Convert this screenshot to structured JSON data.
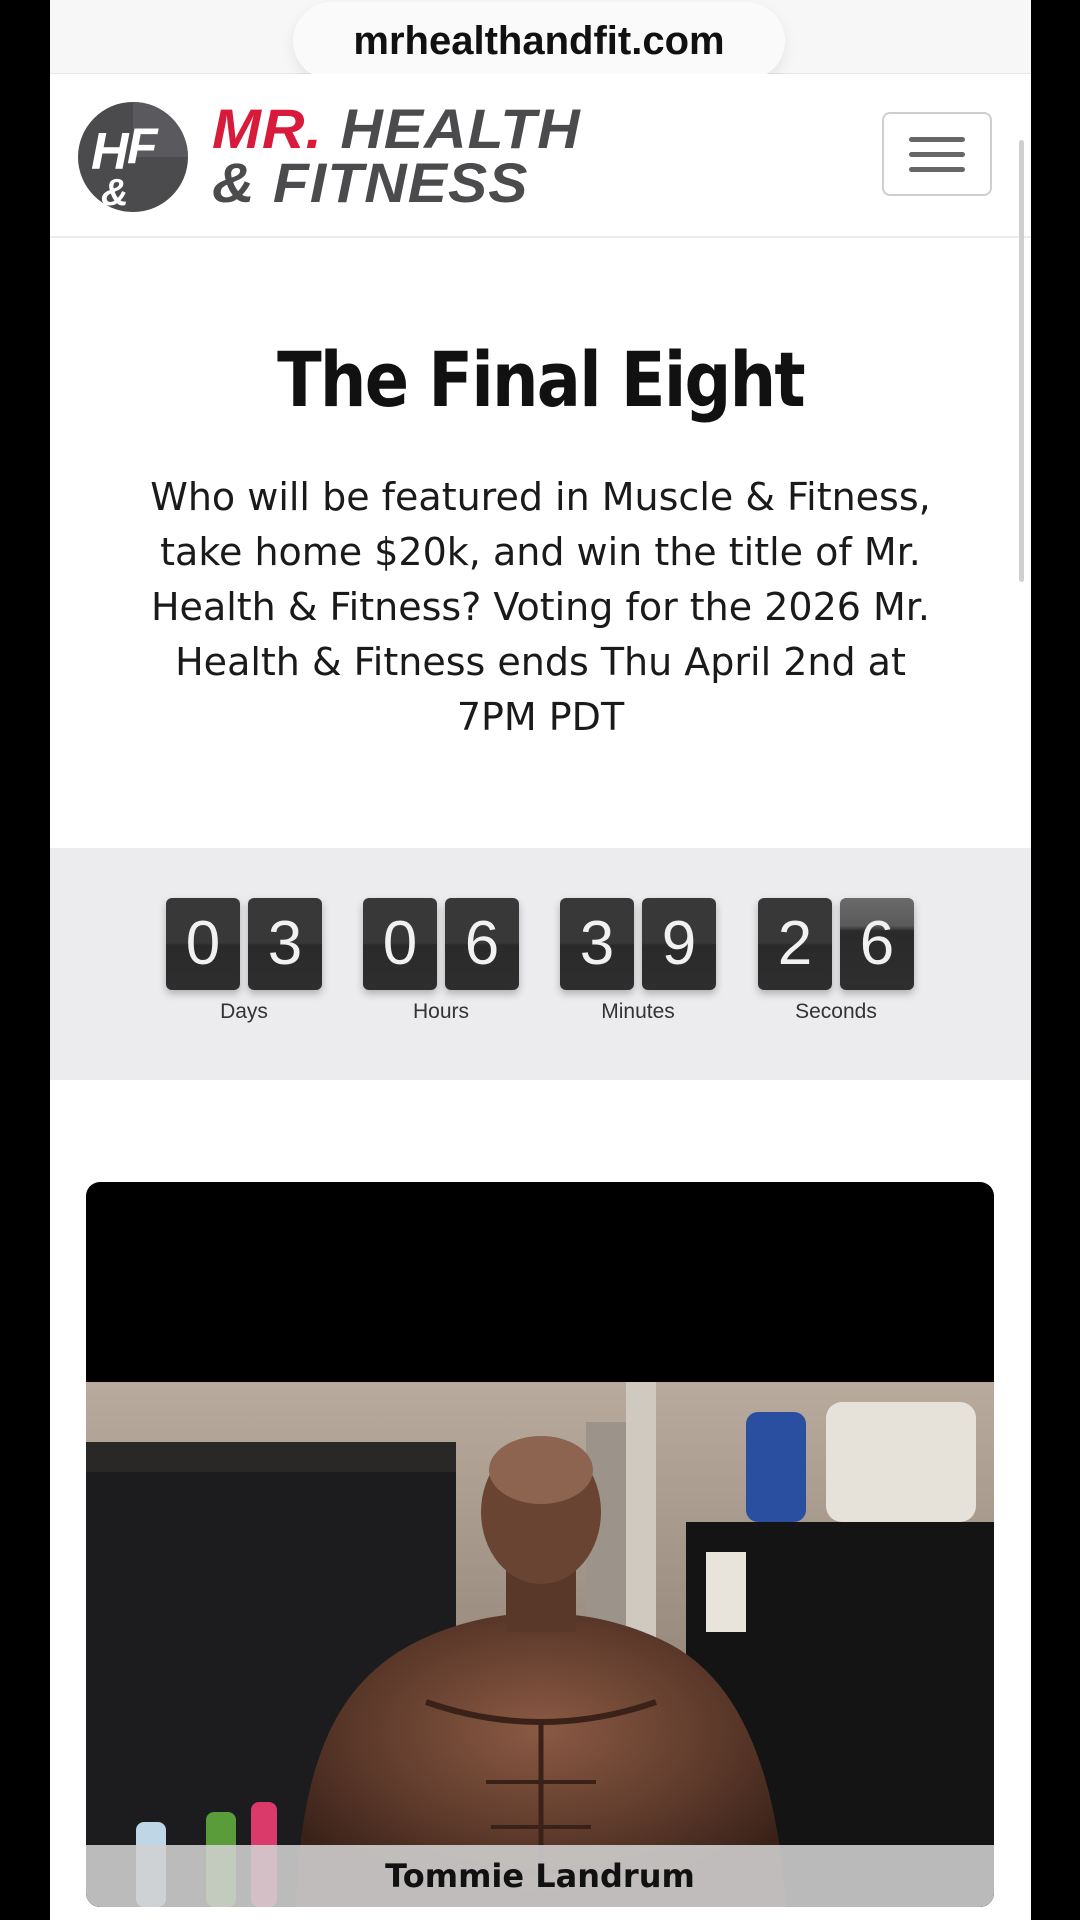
{
  "browser": {
    "url": "mrhealthandfit.com"
  },
  "header": {
    "logo_mark": "H F &",
    "logo_line1_mr": "MR.",
    "logo_line1_rest": "HEALTH",
    "logo_line2": "& FITNESS",
    "menu_icon": "hamburger-icon"
  },
  "hero": {
    "title": "The Final Eight",
    "description": "Who will be featured in Muscle & Fitness, take home $20k, and win the title of Mr. Health & Fitness? Voting for the 2026 Mr. Health & Fitness ends Thu April 2nd at 7PM PDT"
  },
  "countdown": {
    "days": {
      "d1": "0",
      "d2": "3",
      "label": "Days"
    },
    "hours": {
      "d1": "0",
      "d2": "6",
      "label": "Hours"
    },
    "minutes": {
      "d1": "3",
      "d2": "9",
      "label": "Minutes"
    },
    "seconds": {
      "d1": "2",
      "d2": "6",
      "label": "Seconds"
    }
  },
  "contestant": {
    "name": "Tommie Landrum"
  },
  "colors": {
    "brand_red": "#d81b3a",
    "brand_gray": "#4b4b4e",
    "countdown_bg": "#ececef",
    "digit_bg": "#2e2e2e"
  }
}
